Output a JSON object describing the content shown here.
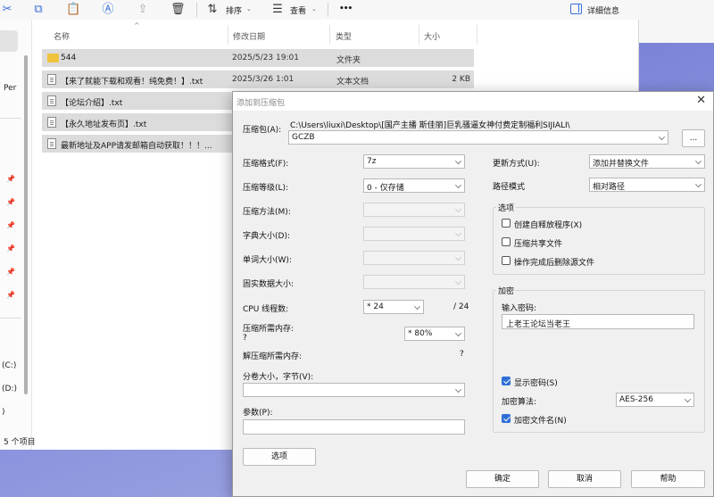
{
  "toolbar": {
    "sort_label": "排序",
    "view_label": "查看",
    "more_label": "•••",
    "details_label": "详细信息"
  },
  "nav": {
    "partial_label": "Per",
    "drive_c": "(C:)",
    "drive_d": "(D:)",
    "drive_other": ")"
  },
  "columns": {
    "name": "名称",
    "modified": "修改日期",
    "type": "类型",
    "size": "大小"
  },
  "files": [
    {
      "name": "544",
      "date": "2025/5/23 19:01",
      "type": "文件夹",
      "size": ""
    },
    {
      "name": "【来了就能下载和观看！纯免费！】.txt",
      "date": "2025/3/26 1:01",
      "type": "文本文档",
      "size": "2 KB"
    },
    {
      "name": "【论坛介绍】.txt",
      "date": "",
      "type": "",
      "size": ""
    },
    {
      "name": "【永久地址发布页】.txt",
      "date": "",
      "type": "",
      "size": ""
    },
    {
      "name": "最新地址及APP请发邮箱自动获取！！！...",
      "date": "",
      "type": "",
      "size": ""
    }
  ],
  "status": {
    "count": "5 个项目"
  },
  "dialog": {
    "title": "添加到压缩包",
    "archive_label": "压缩包(A):",
    "archive_path": "C:\\Users\\liuxi\\Desktop\\[国产主播 斯佳丽]巨乳骚逼女神付费定制福利SIJIALI\\",
    "archive_name": "GCZB",
    "browse_button": "...",
    "format_label": "压缩格式(F):",
    "format_value": "7z",
    "level_label": "压缩等级(L):",
    "level_value": "0 - 仅存储",
    "method_label": "压缩方法(M):",
    "dict_label": "字典大小(D):",
    "word_label": "单词大小(W):",
    "solid_label": "固实数据大小:",
    "cpu_label": "CPU 线程数:",
    "cpu_value": "* 24",
    "cpu_total": "/ 24",
    "mem_label": "压缩所需内存:",
    "mem_question": "?",
    "mem_value": "* 80%",
    "decomp_label": "解压缩所需内存:",
    "decomp_value": "?",
    "split_label": "分卷大小，字节(V):",
    "params_label": "参数(P):",
    "options_button": "选项",
    "update_label": "更新方式(U):",
    "update_value": "添加并替换文件",
    "path_label": "路径模式",
    "path_value": "相对路径",
    "options_group": "选项",
    "opt_sfx": "创建自释放程序(X)",
    "opt_shared": "压缩共享文件",
    "opt_delete": "操作完成后删除源文件",
    "encrypt_group": "加密",
    "password_label": "输入密码:",
    "password_value": "上老王论坛当老王",
    "show_password": "显示密码(S)",
    "enc_method_label": "加密算法:",
    "enc_method_value": "AES-256",
    "encrypt_names": "加密文件名(N)",
    "ok_button": "确定",
    "cancel_button": "取消",
    "help_button": "帮助"
  }
}
